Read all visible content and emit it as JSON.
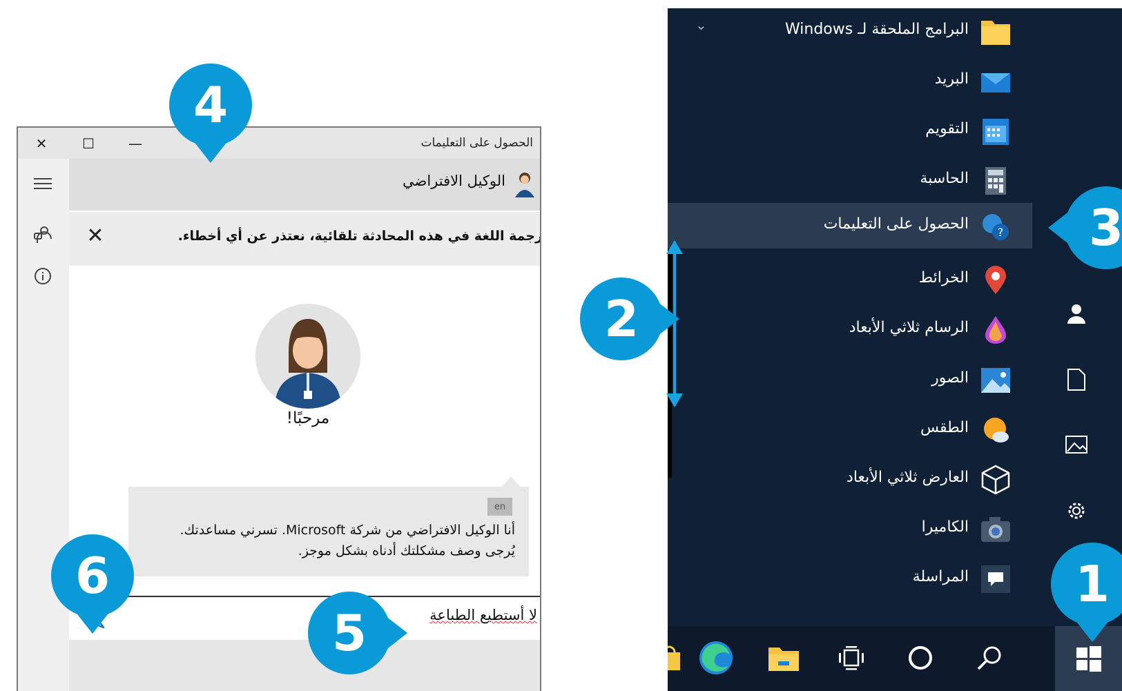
{
  "help_window": {
    "title": "الحصول على التعليمات",
    "minimize": "—",
    "maximize": "☐",
    "close": "✕",
    "agent_name": "الوكيل الافتراضي",
    "notice": "رجمة اللغة في هذه المحادثة تلقائية، نعتذر عن أي أخطاء.",
    "notice_close": "✕",
    "welcome": "مرحبًا!",
    "lang_tag": "en",
    "message_line1": "أنا الوكيل الافتراضي من شركة Microsoft. تسرني مساعدتك.",
    "message_line2": "يُرجى وصف مشكلتك أدناه بشكل موجز.",
    "input_value": "لا أستطيع الطباعة"
  },
  "start_menu": {
    "chevron": "⌄",
    "apps": [
      {
        "label": "البرامج الملحقة لـ Windows",
        "icon": "folder-icon"
      },
      {
        "label": "البريد",
        "icon": "mail-icon"
      },
      {
        "label": "التقويم",
        "icon": "calendar-icon"
      },
      {
        "label": "الحاسبة",
        "icon": "calculator-icon"
      },
      {
        "label": "الحصول على التعليمات",
        "icon": "get-help-icon",
        "selected": true
      },
      {
        "label": "الخرائط",
        "icon": "maps-icon"
      },
      {
        "label": "الرسام ثلاثي الأبعاد",
        "icon": "paint3d-icon"
      },
      {
        "label": "الصور",
        "icon": "photos-icon"
      },
      {
        "label": "الطقس",
        "icon": "weather-icon"
      },
      {
        "label": "العارض ثلاثي الأبعاد",
        "icon": "3d-viewer-icon"
      },
      {
        "label": "الكاميرا",
        "icon": "camera-icon"
      },
      {
        "label": "المراسلة",
        "icon": "messaging-icon"
      }
    ]
  },
  "callouts": {
    "c1": "1",
    "c2": "2",
    "c3": "3",
    "c4": "4",
    "c5": "5",
    "c6": "6"
  },
  "colors": {
    "callout": "#0a9ad8",
    "start_bg": "#102036",
    "selected": "#2a3b52"
  }
}
